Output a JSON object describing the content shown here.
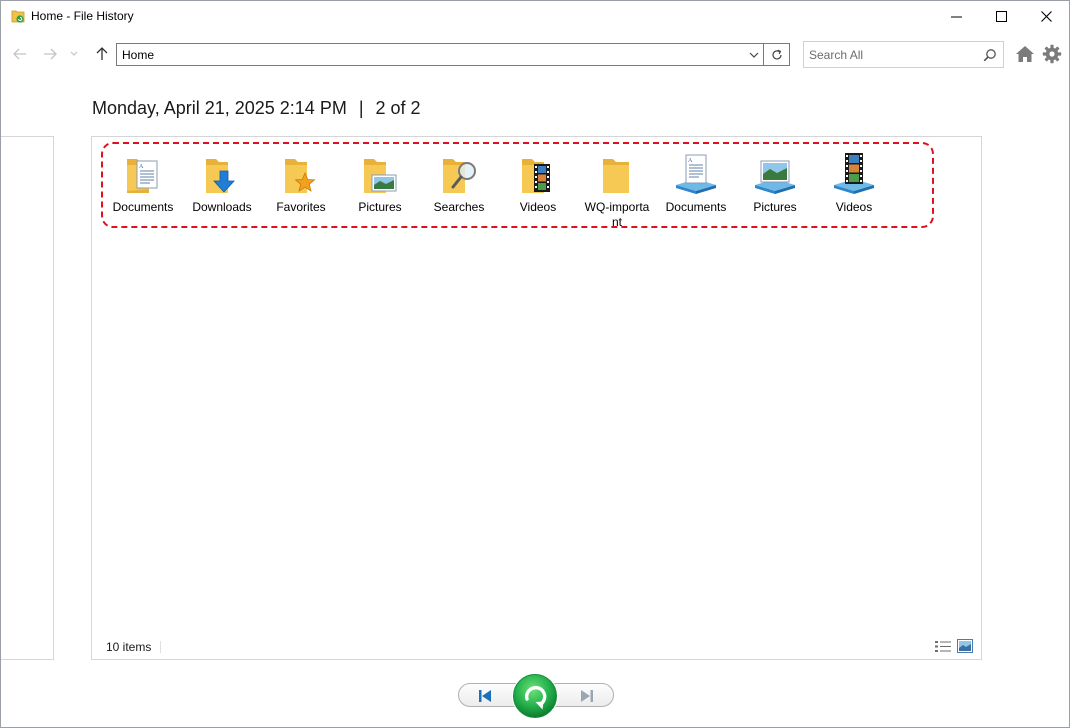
{
  "window": {
    "title": "Home - File History"
  },
  "navbar": {
    "address": "Home",
    "search_placeholder": "Search All"
  },
  "header": {
    "datetime": "Monday, April 21, 2025 2:14 PM",
    "separator": "|",
    "position": "2 of 2"
  },
  "items": [
    {
      "label": "Documents",
      "icon": "documents-folder-icon"
    },
    {
      "label": "Downloads",
      "icon": "downloads-folder-icon"
    },
    {
      "label": "Favorites",
      "icon": "favorites-folder-icon"
    },
    {
      "label": "Pictures",
      "icon": "pictures-folder-icon"
    },
    {
      "label": "Searches",
      "icon": "searches-folder-icon"
    },
    {
      "label": "Videos",
      "icon": "videos-folder-icon"
    },
    {
      "label": "WQ-important",
      "icon": "plain-folder-icon"
    },
    {
      "label": "Documents",
      "icon": "documents-library-icon"
    },
    {
      "label": "Pictures",
      "icon": "pictures-library-icon"
    },
    {
      "label": "Videos",
      "icon": "videos-library-icon"
    }
  ],
  "status": {
    "count": "10 items"
  },
  "colors": {
    "highlight": "#e0101f",
    "folder": "#f5c344",
    "restore": "#22b14c",
    "nav_blue": "#1c6fb8"
  }
}
